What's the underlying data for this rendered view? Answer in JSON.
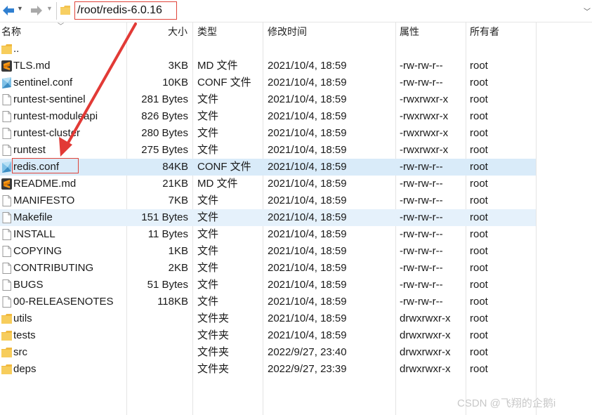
{
  "toolbar": {
    "path": "/root/redis-6.0.16"
  },
  "columns": {
    "name": "名称",
    "size": "大小",
    "type": "类型",
    "modified": "修改时间",
    "perms": "属性",
    "owner": "所有者"
  },
  "rows": [
    {
      "name": "..",
      "size": "",
      "type": "",
      "modified": "",
      "perms": "",
      "owner": "",
      "icon": "folder-icon"
    },
    {
      "name": "TLS.md",
      "size": "3KB",
      "type": "MD 文件",
      "modified": "2021/10/4, 18:59",
      "perms": "-rw-rw-r--",
      "owner": "root",
      "icon": "sublime-icon"
    },
    {
      "name": "sentinel.conf",
      "size": "10KB",
      "type": "CONF 文件",
      "modified": "2021/10/4, 18:59",
      "perms": "-rw-rw-r--",
      "owner": "root",
      "icon": "conf-icon"
    },
    {
      "name": "runtest-sentinel",
      "size": "281 Bytes",
      "type": "文件",
      "modified": "2021/10/4, 18:59",
      "perms": "-rwxrwxr-x",
      "owner": "root",
      "icon": "file-icon"
    },
    {
      "name": "runtest-moduleapi",
      "size": "826 Bytes",
      "type": "文件",
      "modified": "2021/10/4, 18:59",
      "perms": "-rwxrwxr-x",
      "owner": "root",
      "icon": "file-icon"
    },
    {
      "name": "runtest-cluster",
      "size": "280 Bytes",
      "type": "文件",
      "modified": "2021/10/4, 18:59",
      "perms": "-rwxrwxr-x",
      "owner": "root",
      "icon": "file-icon"
    },
    {
      "name": "runtest",
      "size": "275 Bytes",
      "type": "文件",
      "modified": "2021/10/4, 18:59",
      "perms": "-rwxrwxr-x",
      "owner": "root",
      "icon": "file-icon"
    },
    {
      "name": "redis.conf",
      "size": "84KB",
      "type": "CONF 文件",
      "modified": "2021/10/4, 18:59",
      "perms": "-rw-rw-r--",
      "owner": "root",
      "icon": "conf-icon"
    },
    {
      "name": "README.md",
      "size": "21KB",
      "type": "MD 文件",
      "modified": "2021/10/4, 18:59",
      "perms": "-rw-rw-r--",
      "owner": "root",
      "icon": "sublime-icon"
    },
    {
      "name": "MANIFESTO",
      "size": "7KB",
      "type": "文件",
      "modified": "2021/10/4, 18:59",
      "perms": "-rw-rw-r--",
      "owner": "root",
      "icon": "file-icon"
    },
    {
      "name": "Makefile",
      "size": "151 Bytes",
      "type": "文件",
      "modified": "2021/10/4, 18:59",
      "perms": "-rw-rw-r--",
      "owner": "root",
      "icon": "file-icon"
    },
    {
      "name": "INSTALL",
      "size": "11 Bytes",
      "type": "文件",
      "modified": "2021/10/4, 18:59",
      "perms": "-rw-rw-r--",
      "owner": "root",
      "icon": "file-icon"
    },
    {
      "name": "COPYING",
      "size": "1KB",
      "type": "文件",
      "modified": "2021/10/4, 18:59",
      "perms": "-rw-rw-r--",
      "owner": "root",
      "icon": "file-icon"
    },
    {
      "name": "CONTRIBUTING",
      "size": "2KB",
      "type": "文件",
      "modified": "2021/10/4, 18:59",
      "perms": "-rw-rw-r--",
      "owner": "root",
      "icon": "file-icon"
    },
    {
      "name": "BUGS",
      "size": "51 Bytes",
      "type": "文件",
      "modified": "2021/10/4, 18:59",
      "perms": "-rw-rw-r--",
      "owner": "root",
      "icon": "file-icon"
    },
    {
      "name": "00-RELEASENOTES",
      "size": "118KB",
      "type": "文件",
      "modified": "2021/10/4, 18:59",
      "perms": "-rw-rw-r--",
      "owner": "root",
      "icon": "file-icon"
    },
    {
      "name": "utils",
      "size": "",
      "type": "文件夹",
      "modified": "2021/10/4, 18:59",
      "perms": "drwxrwxr-x",
      "owner": "root",
      "icon": "folder-icon"
    },
    {
      "name": "tests",
      "size": "",
      "type": "文件夹",
      "modified": "2021/10/4, 18:59",
      "perms": "drwxrwxr-x",
      "owner": "root",
      "icon": "folder-icon"
    },
    {
      "name": "src",
      "size": "",
      "type": "文件夹",
      "modified": "2022/9/27, 23:40",
      "perms": "drwxrwxr-x",
      "owner": "root",
      "icon": "folder-icon"
    },
    {
      "name": "deps",
      "size": "",
      "type": "文件夹",
      "modified": "2022/9/27, 23:39",
      "perms": "drwxrwxr-x",
      "owner": "root",
      "icon": "folder-icon"
    }
  ],
  "selected_row": 7,
  "hover_row": 10,
  "watermark": "CSDN @飞翔的企鹅i",
  "colors": {
    "accent_selection": "#d9ebf9",
    "annotation_red": "#e0443a"
  }
}
